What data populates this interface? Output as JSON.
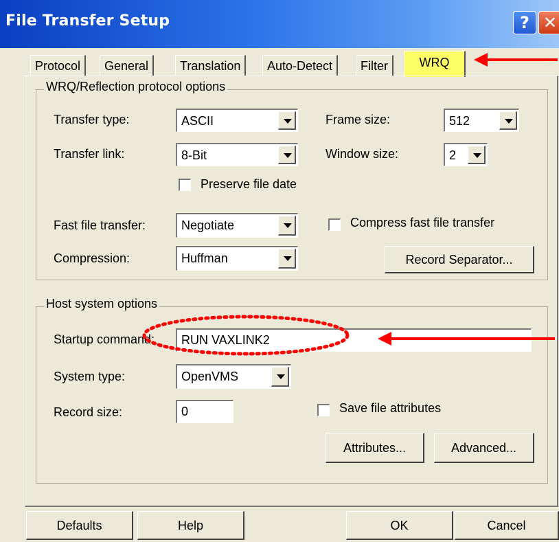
{
  "window": {
    "title": "File Transfer Setup"
  },
  "tabs": [
    {
      "label": "Protocol"
    },
    {
      "label": "General"
    },
    {
      "label": "Translation"
    },
    {
      "label": "Auto-Detect"
    },
    {
      "label": "Filter"
    },
    {
      "label": "WRQ"
    }
  ],
  "wrq": {
    "group_title": "WRQ/Reflection protocol options",
    "transfer_type": {
      "label": "Transfer type:",
      "value": "ASCII"
    },
    "frame_size": {
      "label": "Frame size:",
      "value": "512"
    },
    "transfer_link": {
      "label": "Transfer link:",
      "value": "8-Bit"
    },
    "window_size": {
      "label": "Window size:",
      "value": "2"
    },
    "preserve_date": {
      "label": "Preserve file date"
    },
    "fast_transfer": {
      "label": "Fast file transfer:",
      "value": "Negotiate"
    },
    "compress_fast": {
      "label": "Compress fast file transfer"
    },
    "compression": {
      "label": "Compression:",
      "value": "Huffman"
    },
    "record_separator_button": "Record Separator..."
  },
  "host": {
    "group_title": "Host system options",
    "startup_command": {
      "label": "Startup command:",
      "value": "RUN VAXLINK2"
    },
    "system_type": {
      "label": "System type:",
      "value": "OpenVMS"
    },
    "record_size": {
      "label": "Record size:",
      "value": "0"
    },
    "save_attributes": {
      "label": "Save file attributes"
    },
    "attributes_button": "Attributes...",
    "advanced_button": "Advanced..."
  },
  "footer": {
    "defaults": "Defaults",
    "help": "Help",
    "ok": "OK",
    "cancel": "Cancel"
  },
  "colors": {
    "annotation": "#ff0000",
    "highlight": "#ffff66",
    "titlebar": "#0a3fc2"
  }
}
